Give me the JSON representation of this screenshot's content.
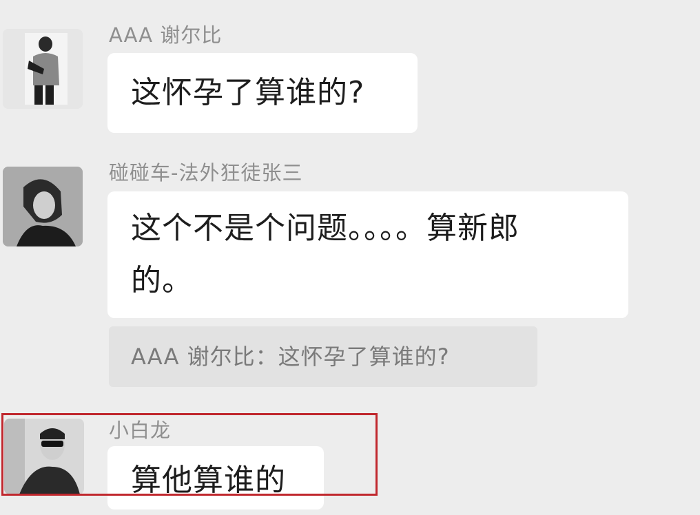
{
  "messages": [
    {
      "sender": "AAA 谢尔比",
      "text": "这怀孕了算谁的?"
    },
    {
      "sender": "碰碰车-法外狂徒张三",
      "text_line1": "这个不是个问题。。。。算新郎",
      "text_line2": "的。",
      "quote": "AAA 谢尔比：这怀孕了算谁的?"
    },
    {
      "sender": "小白龙",
      "text": "算他算谁的"
    }
  ],
  "colors": {
    "background": "#ededed",
    "bubble": "#ffffff",
    "quote_bg": "#e2e2e2",
    "highlight": "#c0272d"
  },
  "icons": [
    "avatar-shelby",
    "avatar-zhangsan",
    "avatar-xiaobailong"
  ]
}
